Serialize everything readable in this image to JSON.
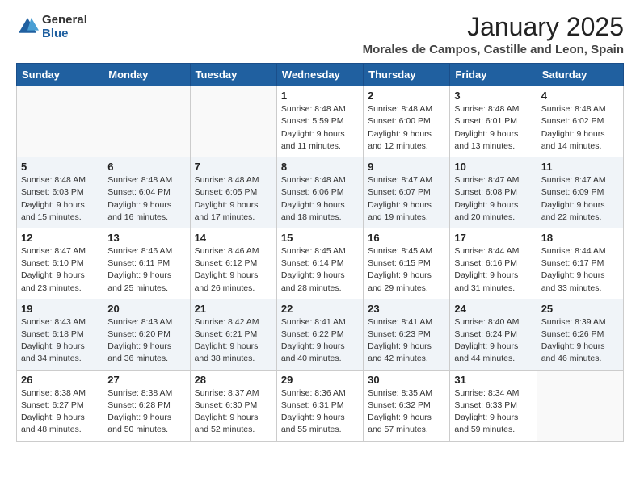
{
  "logo": {
    "general": "General",
    "blue": "Blue"
  },
  "header": {
    "month": "January 2025",
    "location": "Morales de Campos, Castille and Leon, Spain"
  },
  "weekdays": [
    "Sunday",
    "Monday",
    "Tuesday",
    "Wednesday",
    "Thursday",
    "Friday",
    "Saturday"
  ],
  "weeks": [
    [
      {
        "day": null
      },
      {
        "day": null
      },
      {
        "day": null
      },
      {
        "day": 1,
        "sunrise": "8:48 AM",
        "sunset": "5:59 PM",
        "daylight": "9 hours and 11 minutes."
      },
      {
        "day": 2,
        "sunrise": "8:48 AM",
        "sunset": "6:00 PM",
        "daylight": "9 hours and 12 minutes."
      },
      {
        "day": 3,
        "sunrise": "8:48 AM",
        "sunset": "6:01 PM",
        "daylight": "9 hours and 13 minutes."
      },
      {
        "day": 4,
        "sunrise": "8:48 AM",
        "sunset": "6:02 PM",
        "daylight": "9 hours and 14 minutes."
      }
    ],
    [
      {
        "day": 5,
        "sunrise": "8:48 AM",
        "sunset": "6:03 PM",
        "daylight": "9 hours and 15 minutes."
      },
      {
        "day": 6,
        "sunrise": "8:48 AM",
        "sunset": "6:04 PM",
        "daylight": "9 hours and 16 minutes."
      },
      {
        "day": 7,
        "sunrise": "8:48 AM",
        "sunset": "6:05 PM",
        "daylight": "9 hours and 17 minutes."
      },
      {
        "day": 8,
        "sunrise": "8:48 AM",
        "sunset": "6:06 PM",
        "daylight": "9 hours and 18 minutes."
      },
      {
        "day": 9,
        "sunrise": "8:47 AM",
        "sunset": "6:07 PM",
        "daylight": "9 hours and 19 minutes."
      },
      {
        "day": 10,
        "sunrise": "8:47 AM",
        "sunset": "6:08 PM",
        "daylight": "9 hours and 20 minutes."
      },
      {
        "day": 11,
        "sunrise": "8:47 AM",
        "sunset": "6:09 PM",
        "daylight": "9 hours and 22 minutes."
      }
    ],
    [
      {
        "day": 12,
        "sunrise": "8:47 AM",
        "sunset": "6:10 PM",
        "daylight": "9 hours and 23 minutes."
      },
      {
        "day": 13,
        "sunrise": "8:46 AM",
        "sunset": "6:11 PM",
        "daylight": "9 hours and 25 minutes."
      },
      {
        "day": 14,
        "sunrise": "8:46 AM",
        "sunset": "6:12 PM",
        "daylight": "9 hours and 26 minutes."
      },
      {
        "day": 15,
        "sunrise": "8:45 AM",
        "sunset": "6:14 PM",
        "daylight": "9 hours and 28 minutes."
      },
      {
        "day": 16,
        "sunrise": "8:45 AM",
        "sunset": "6:15 PM",
        "daylight": "9 hours and 29 minutes."
      },
      {
        "day": 17,
        "sunrise": "8:44 AM",
        "sunset": "6:16 PM",
        "daylight": "9 hours and 31 minutes."
      },
      {
        "day": 18,
        "sunrise": "8:44 AM",
        "sunset": "6:17 PM",
        "daylight": "9 hours and 33 minutes."
      }
    ],
    [
      {
        "day": 19,
        "sunrise": "8:43 AM",
        "sunset": "6:18 PM",
        "daylight": "9 hours and 34 minutes."
      },
      {
        "day": 20,
        "sunrise": "8:43 AM",
        "sunset": "6:20 PM",
        "daylight": "9 hours and 36 minutes."
      },
      {
        "day": 21,
        "sunrise": "8:42 AM",
        "sunset": "6:21 PM",
        "daylight": "9 hours and 38 minutes."
      },
      {
        "day": 22,
        "sunrise": "8:41 AM",
        "sunset": "6:22 PM",
        "daylight": "9 hours and 40 minutes."
      },
      {
        "day": 23,
        "sunrise": "8:41 AM",
        "sunset": "6:23 PM",
        "daylight": "9 hours and 42 minutes."
      },
      {
        "day": 24,
        "sunrise": "8:40 AM",
        "sunset": "6:24 PM",
        "daylight": "9 hours and 44 minutes."
      },
      {
        "day": 25,
        "sunrise": "8:39 AM",
        "sunset": "6:26 PM",
        "daylight": "9 hours and 46 minutes."
      }
    ],
    [
      {
        "day": 26,
        "sunrise": "8:38 AM",
        "sunset": "6:27 PM",
        "daylight": "9 hours and 48 minutes."
      },
      {
        "day": 27,
        "sunrise": "8:38 AM",
        "sunset": "6:28 PM",
        "daylight": "9 hours and 50 minutes."
      },
      {
        "day": 28,
        "sunrise": "8:37 AM",
        "sunset": "6:30 PM",
        "daylight": "9 hours and 52 minutes."
      },
      {
        "day": 29,
        "sunrise": "8:36 AM",
        "sunset": "6:31 PM",
        "daylight": "9 hours and 55 minutes."
      },
      {
        "day": 30,
        "sunrise": "8:35 AM",
        "sunset": "6:32 PM",
        "daylight": "9 hours and 57 minutes."
      },
      {
        "day": 31,
        "sunrise": "8:34 AM",
        "sunset": "6:33 PM",
        "daylight": "9 hours and 59 minutes."
      },
      {
        "day": null
      }
    ]
  ]
}
